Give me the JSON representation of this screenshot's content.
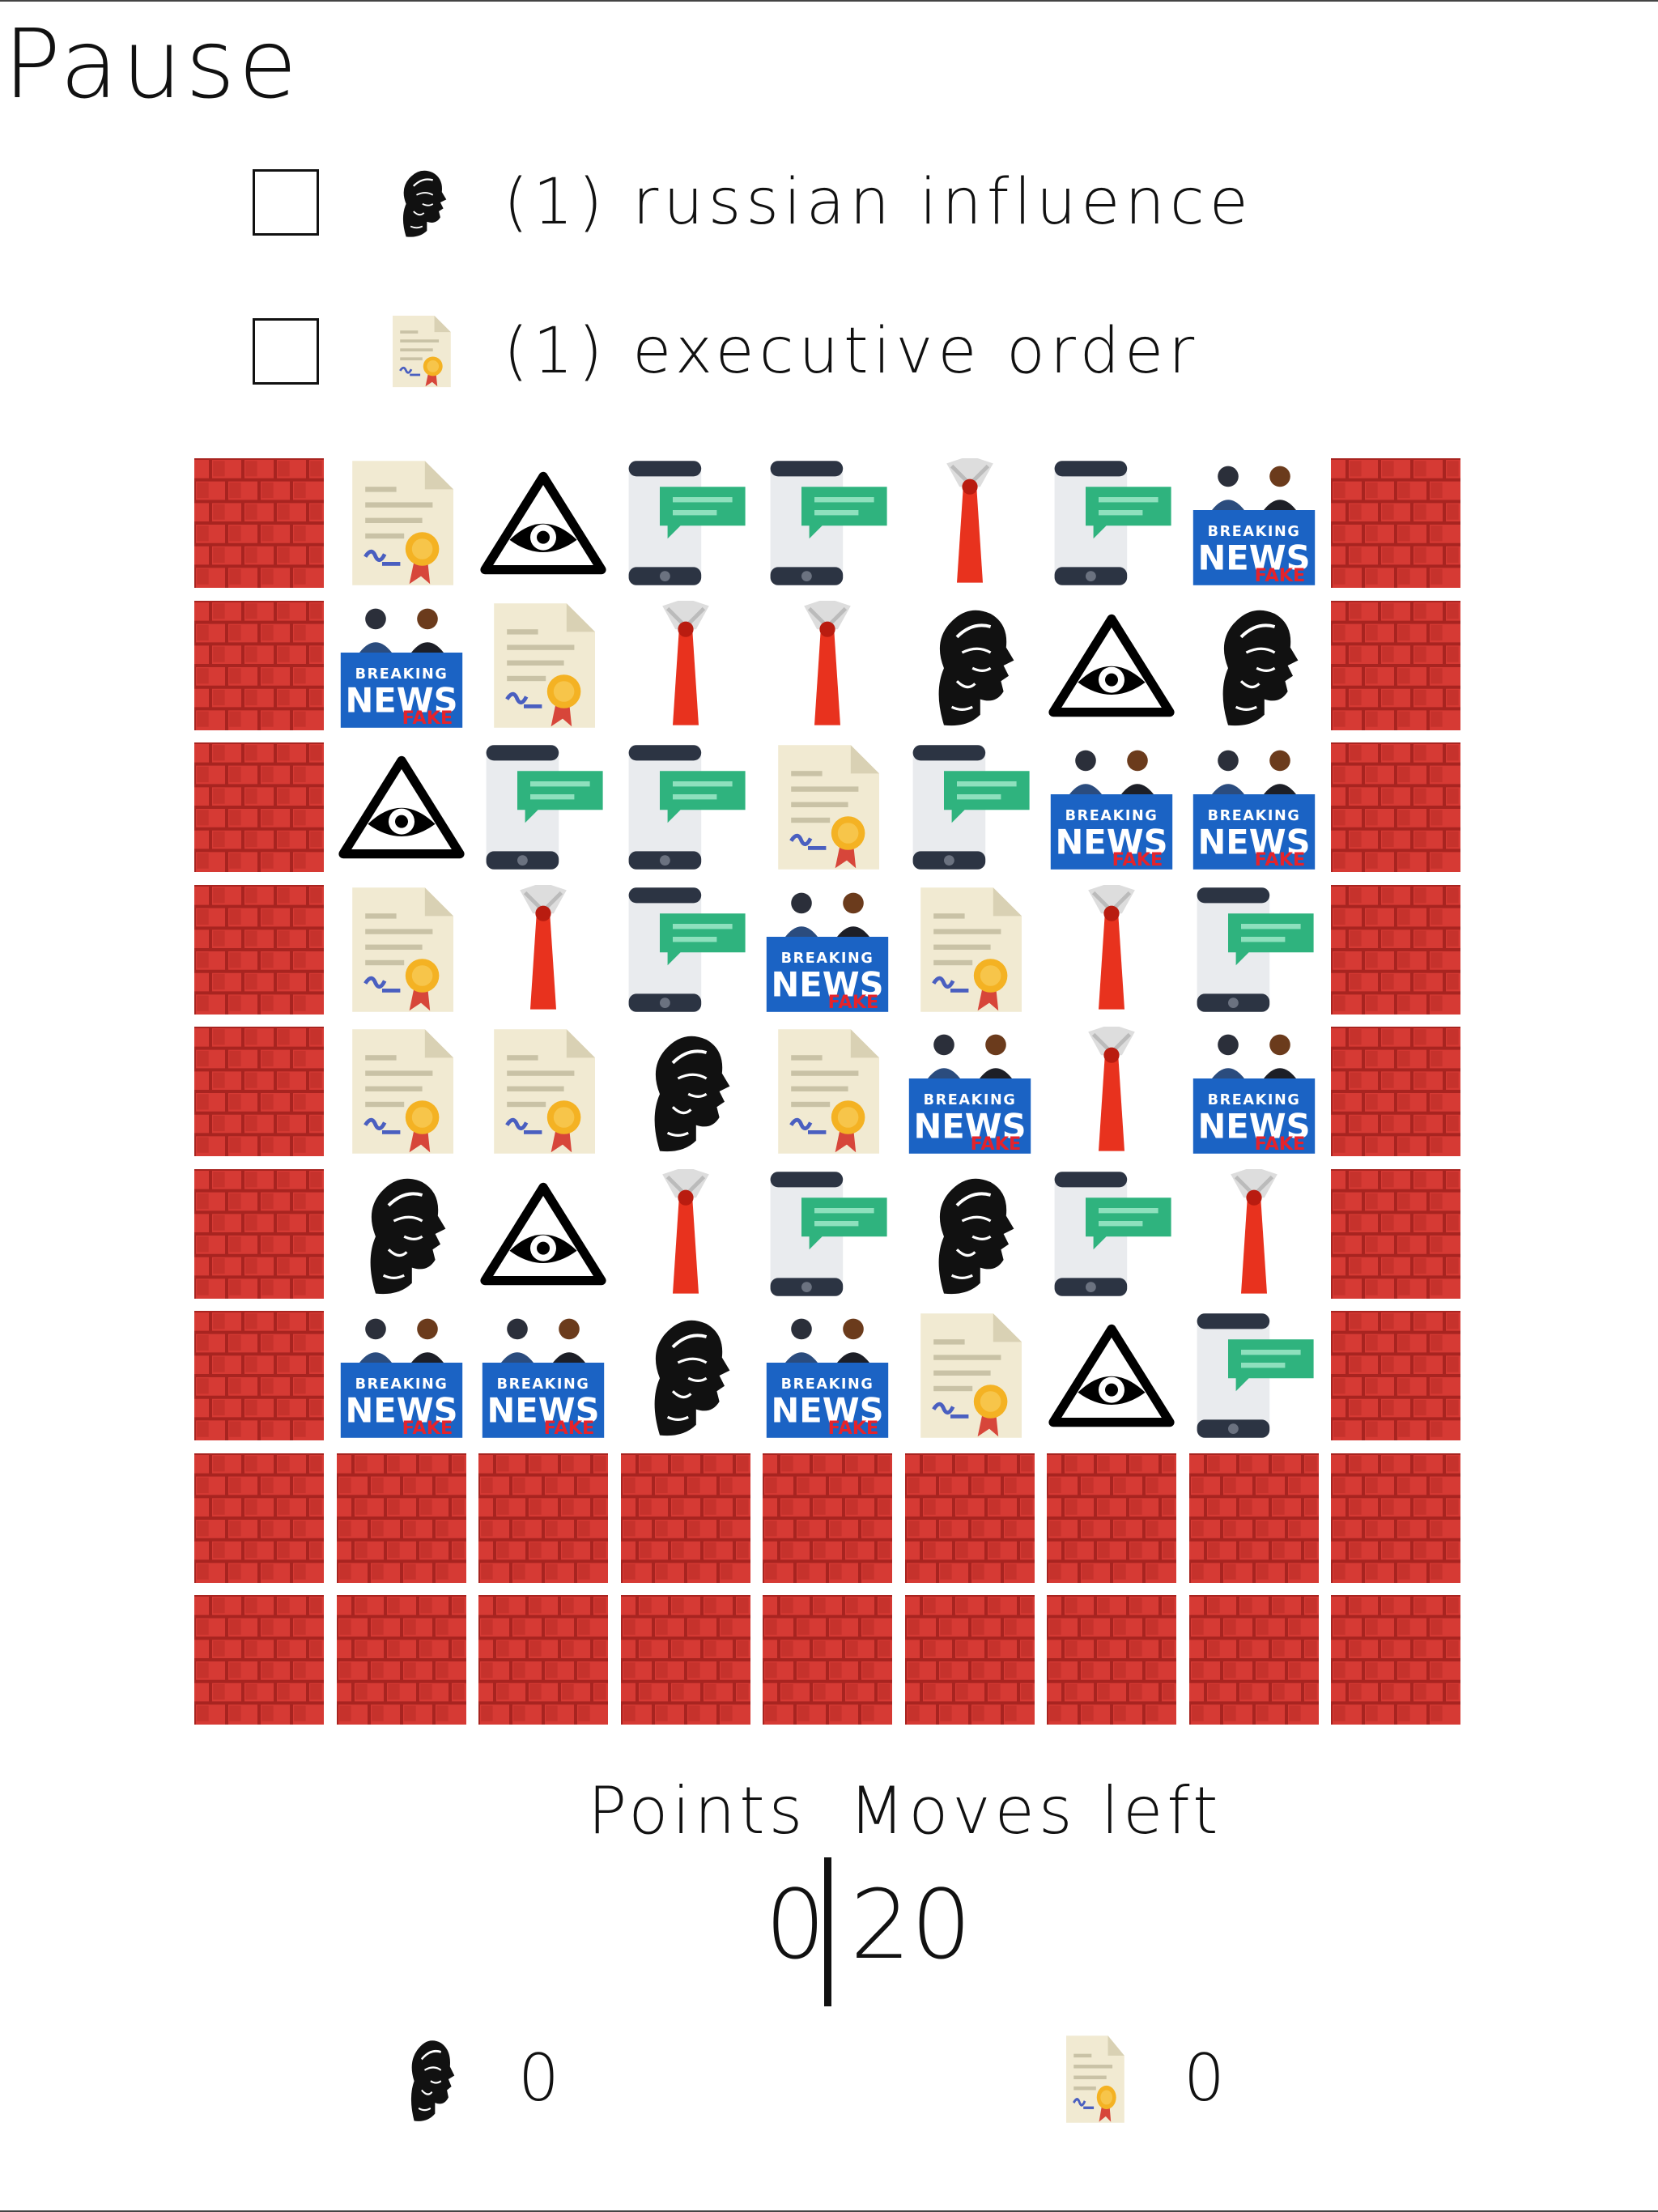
{
  "header": {
    "pause_label": "Pause"
  },
  "goals": [
    {
      "count_label": "(1) russian influence",
      "icon": "putin-icon",
      "completed": false
    },
    {
      "count_label": "(1) executive order",
      "icon": "executive-order-icon",
      "completed": false
    }
  ],
  "board": {
    "columns": 9,
    "rows": 9,
    "cells": [
      [
        "wall",
        "order",
        "eye",
        "phone",
        "phone",
        "tie",
        "phone",
        "news",
        "wall"
      ],
      [
        "wall",
        "news",
        "order",
        "tie",
        "tie",
        "putin",
        "eye",
        "putin",
        "wall"
      ],
      [
        "wall",
        "eye",
        "phone",
        "phone",
        "order",
        "phone",
        "news",
        "news",
        "wall"
      ],
      [
        "wall",
        "order",
        "tie",
        "phone",
        "news",
        "order",
        "tie",
        "phone",
        "wall"
      ],
      [
        "wall",
        "order",
        "order",
        "putin",
        "order",
        "news",
        "tie",
        "news",
        "wall"
      ],
      [
        "wall",
        "putin",
        "eye",
        "tie",
        "phone",
        "putin",
        "phone",
        "tie",
        "wall"
      ],
      [
        "wall",
        "news",
        "news",
        "putin",
        "news",
        "order",
        "eye",
        "phone",
        "wall"
      ],
      [
        "wall",
        "wall",
        "wall",
        "wall",
        "wall",
        "wall",
        "wall",
        "wall",
        "wall"
      ],
      [
        "wall",
        "wall",
        "wall",
        "wall",
        "wall",
        "wall",
        "wall",
        "wall",
        "wall"
      ]
    ],
    "tile_icons": {
      "wall": "brick-wall-icon",
      "order": "executive-order-icon",
      "eye": "all-seeing-eye-icon",
      "phone": "phone-message-icon",
      "tie": "red-tie-icon",
      "news": "fake-news-icon",
      "putin": "putin-icon"
    },
    "news_text": {
      "breaking": "BREAKING",
      "news": "NEWS",
      "fake": "FAKE"
    }
  },
  "score": {
    "points_label": "Points",
    "moves_label": "Moves left",
    "points": "0",
    "moves_left": "20"
  },
  "progress": [
    {
      "icon": "putin-icon",
      "value": "0"
    },
    {
      "icon": "executive-order-icon",
      "value": "0"
    }
  ],
  "colors": {
    "brick": "#d63a34",
    "brick_dark": "#a82420",
    "tie": "#e8321e",
    "phone_body": "#e9ebee",
    "phone_dark": "#2c3443",
    "chat": "#2fb37e",
    "paper": "#f1ead2",
    "seal": "#f4b223",
    "ribbon": "#d7463a",
    "news_blue": "#1b63c4",
    "fake_red": "#e5232b"
  }
}
